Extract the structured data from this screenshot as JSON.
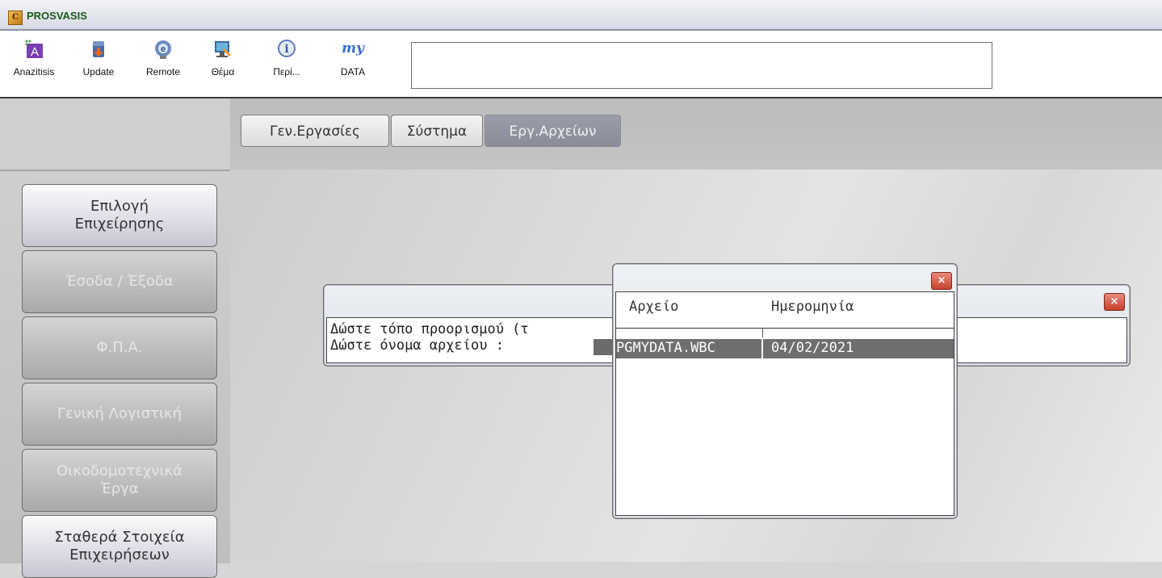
{
  "window": {
    "title": "PROSVASIS",
    "icon": "app-logo-icon"
  },
  "toolbar": {
    "buttons": [
      {
        "label": "Anazitisis",
        "icon": "search-a-icon"
      },
      {
        "label": "Update",
        "icon": "update-icon"
      },
      {
        "label": "Remote",
        "icon": "remote-support-icon"
      },
      {
        "label": "Θέμα",
        "icon": "theme-icon"
      },
      {
        "label": "Περί...",
        "icon": "info-icon"
      },
      {
        "label": "DATA",
        "icon": "my-data-icon",
        "icon_text": "my"
      }
    ],
    "search_value": ""
  },
  "tabs": [
    {
      "label": "Γεν.Εργασίες",
      "active": false
    },
    {
      "label": "Σύστημα",
      "active": false
    },
    {
      "label": "Εργ.Αρχείων",
      "active": true
    }
  ],
  "sidebar": {
    "items": [
      {
        "line1": "Επιλογή",
        "line2": "Επιχείρησης",
        "enabled": true
      },
      {
        "line1": "Έσοδα / Έξοδα",
        "line2": "",
        "enabled": false
      },
      {
        "line1": "Φ.Π.Α.",
        "line2": "",
        "enabled": false
      },
      {
        "line1": "Γενική Λογιστική",
        "line2": "",
        "enabled": false
      },
      {
        "line1": "Οικοδομοτεχνικά",
        "line2": "Έργα",
        "enabled": false
      },
      {
        "line1": "Σταθερά Στοιχεία",
        "line2": "Επιχειρήσεων",
        "enabled": true
      }
    ]
  },
  "export_dialog": {
    "close_label": "×",
    "prompt_destination": "Δώστε τόπο προορισμού (τ",
    "prompt_filename": "Δώστε όνομα αρχείου :"
  },
  "file_list_dialog": {
    "close_label": "×",
    "columns": [
      "Αρχείο",
      "Ημερομηνία"
    ],
    "rows": [
      {
        "file": "PGMYDATA.WBC",
        "date": "04/02/2021"
      }
    ]
  },
  "colors": {
    "title_text": "#1a5a1a",
    "active_tab": "#8a8c9a",
    "close_button": "#c8402c",
    "selection": "#6e6e6e"
  }
}
